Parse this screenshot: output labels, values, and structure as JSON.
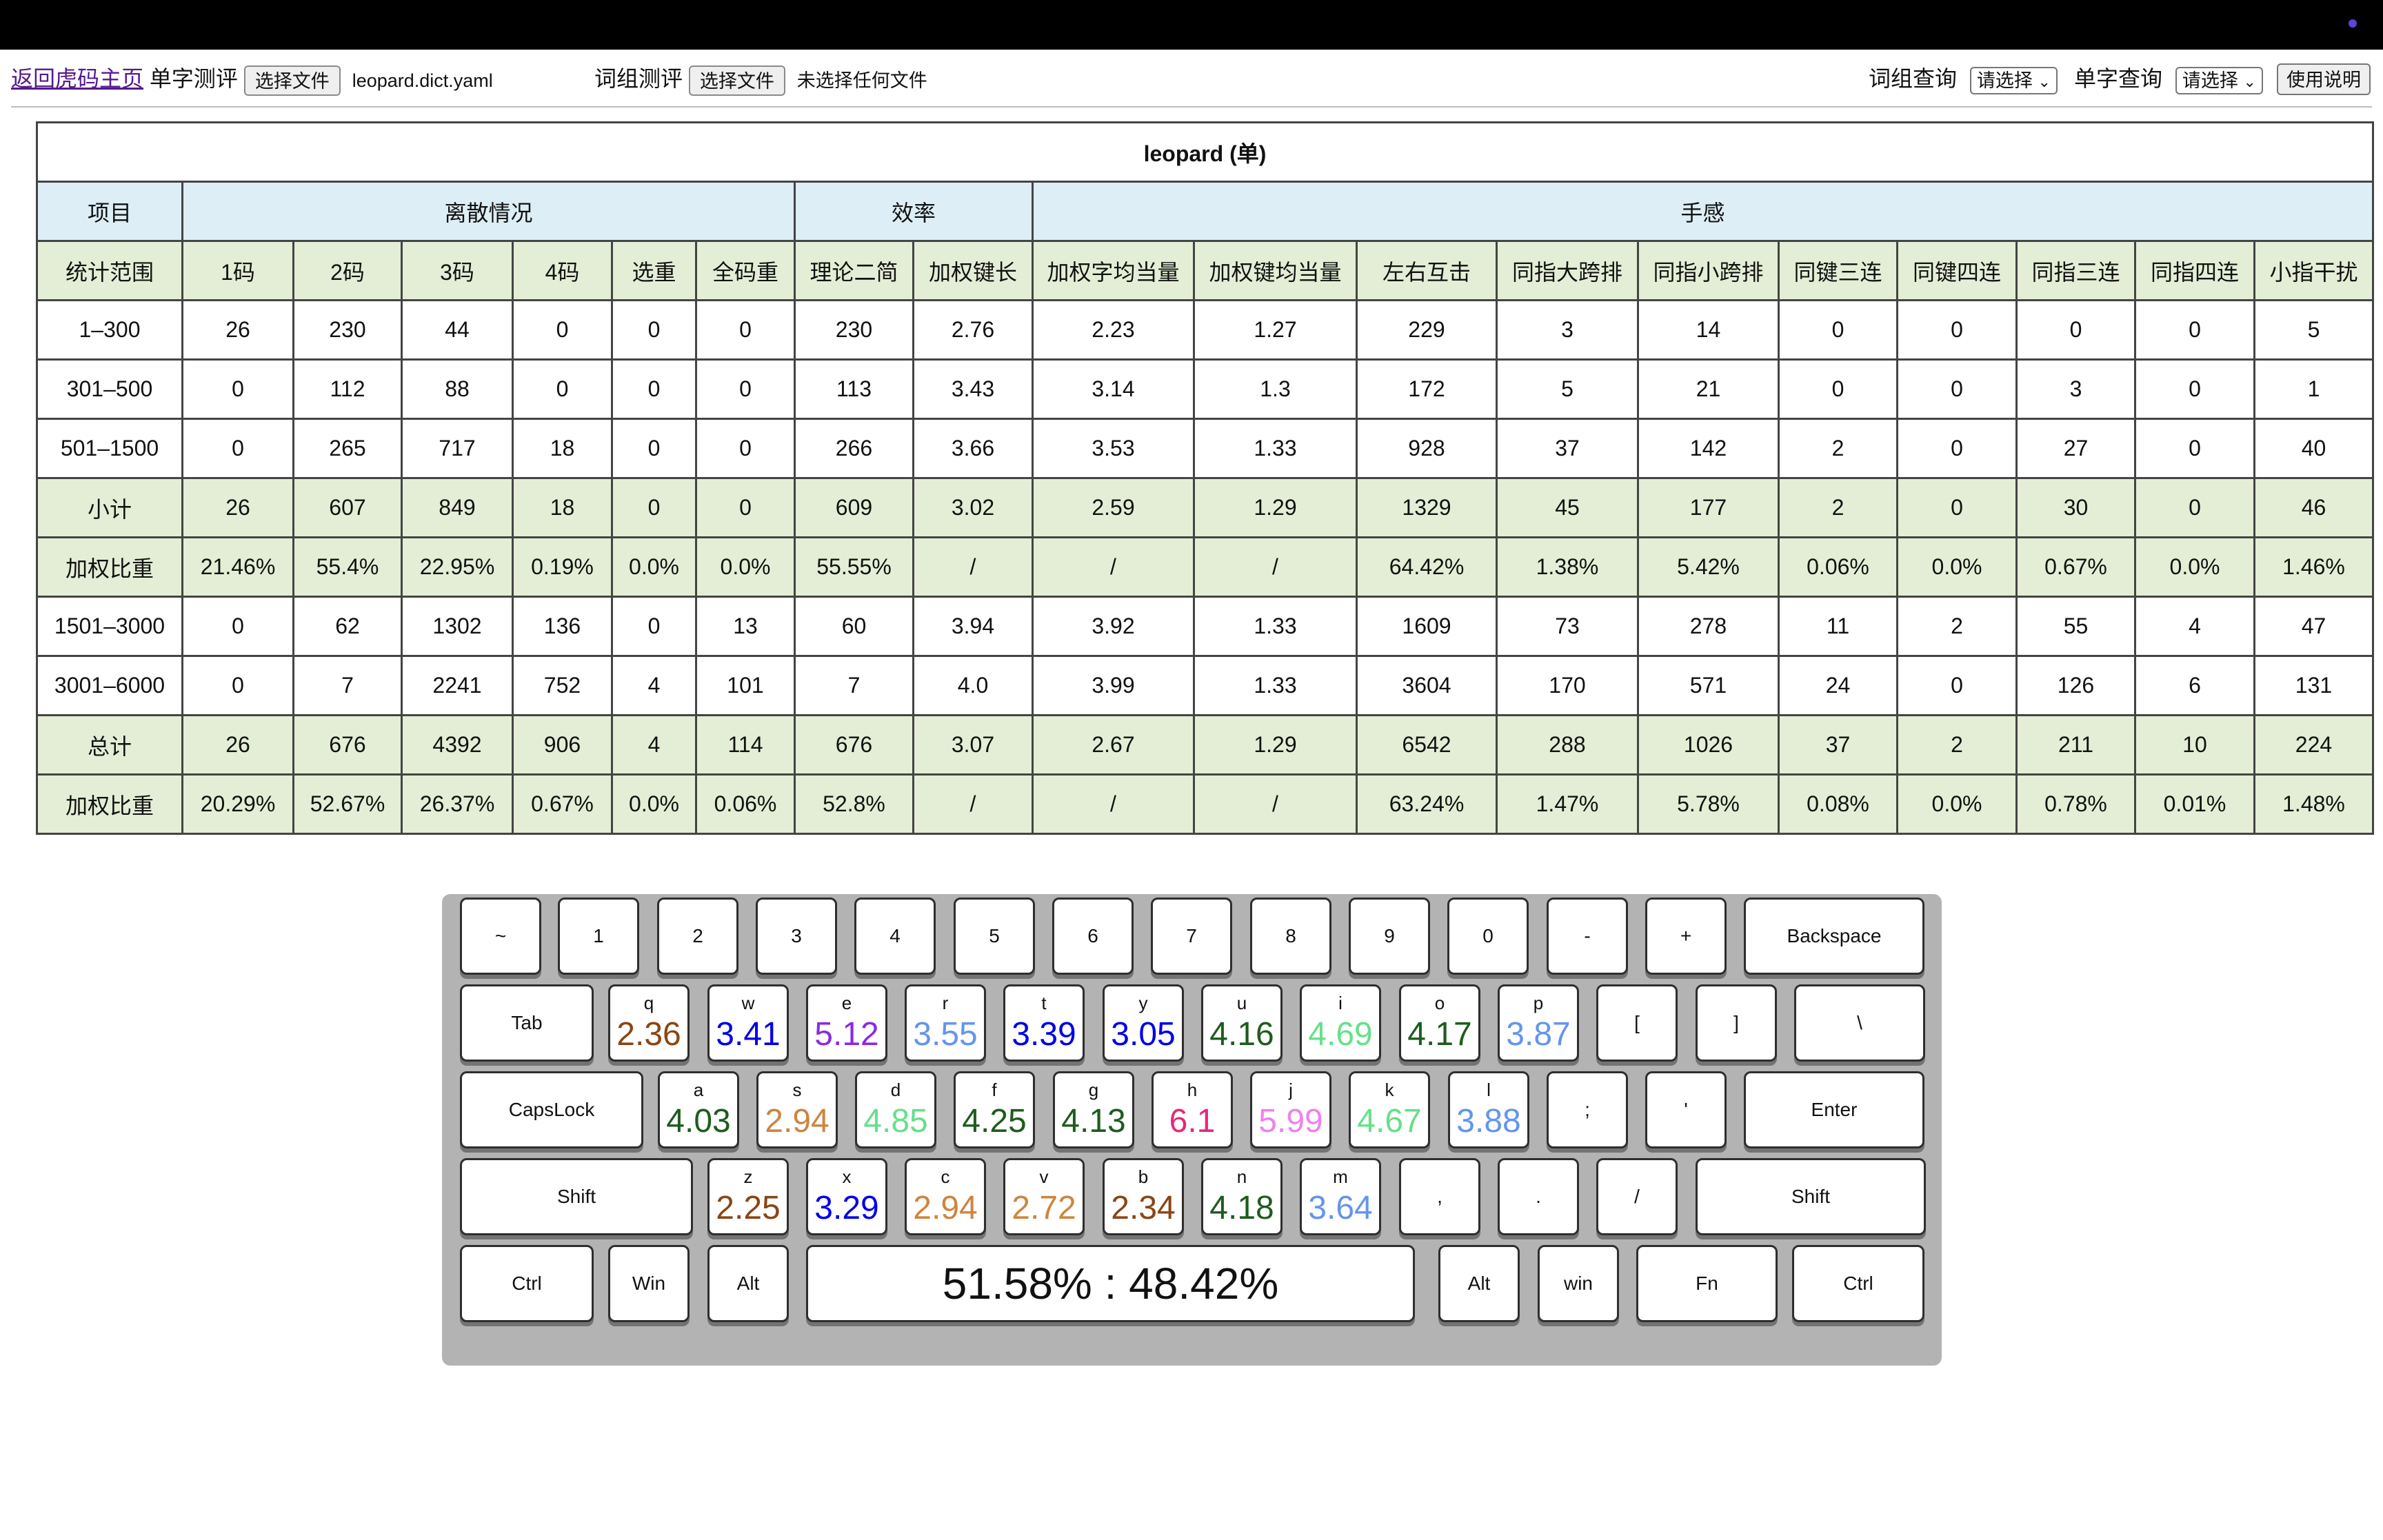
{
  "toolbar": {
    "back_link": "返回虎码主页",
    "single_test_label": "单字测评",
    "choose_file": "选择文件",
    "single_file_name": "leopard.dict.yaml",
    "phrase_test_label": "词组测评",
    "phrase_file_name": "未选择任何文件",
    "phrase_query_label": "词组查询",
    "single_query_label": "单字查询",
    "select_placeholder": "请选择",
    "help_button": "使用说明"
  },
  "table": {
    "title": "leopard (单)",
    "groups": [
      {
        "label": "项目",
        "span": 1
      },
      {
        "label": "离散情况",
        "span": 6
      },
      {
        "label": "效率",
        "span": 2
      },
      {
        "label": "手感",
        "span": 11
      }
    ],
    "columns": [
      "统计范围",
      "1码",
      "2码",
      "3码",
      "4码",
      "选重",
      "全码重",
      "理论二简",
      "加权键长",
      "加权字均当量",
      "加权键均当量",
      "左右互击",
      "同指大跨排",
      "同指小跨排",
      "同键三连",
      "同键四连",
      "同指三连",
      "同指四连",
      "小指干扰"
    ],
    "rows": [
      {
        "style": "white",
        "cells": [
          "1–300",
          "26",
          "230",
          "44",
          "0",
          "0",
          "0",
          "230",
          "2.76",
          "2.23",
          "1.27",
          "229",
          "3",
          "14",
          "0",
          "0",
          "0",
          "0",
          "5"
        ]
      },
      {
        "style": "white",
        "cells": [
          "301–500",
          "0",
          "112",
          "88",
          "0",
          "0",
          "0",
          "113",
          "3.43",
          "3.14",
          "1.3",
          "172",
          "5",
          "21",
          "0",
          "0",
          "3",
          "0",
          "1"
        ]
      },
      {
        "style": "white",
        "cells": [
          "501–1500",
          "0",
          "265",
          "717",
          "18",
          "0",
          "0",
          "266",
          "3.66",
          "3.53",
          "1.33",
          "928",
          "37",
          "142",
          "2",
          "0",
          "27",
          "0",
          "40"
        ]
      },
      {
        "style": "green",
        "cells": [
          "小计",
          "26",
          "607",
          "849",
          "18",
          "0",
          "0",
          "609",
          "3.02",
          "2.59",
          "1.29",
          "1329",
          "45",
          "177",
          "2",
          "0",
          "30",
          "0",
          "46"
        ]
      },
      {
        "style": "green",
        "cells": [
          "加权比重",
          "21.46%",
          "55.4%",
          "22.95%",
          "0.19%",
          "0.0%",
          "0.0%",
          "55.55%",
          "/",
          "/",
          "/",
          "64.42%",
          "1.38%",
          "5.42%",
          "0.06%",
          "0.0%",
          "0.67%",
          "0.0%",
          "1.46%"
        ]
      },
      {
        "style": "white",
        "cells": [
          "1501–3000",
          "0",
          "62",
          "1302",
          "136",
          "0",
          "13",
          "60",
          "3.94",
          "3.92",
          "1.33",
          "1609",
          "73",
          "278",
          "11",
          "2",
          "55",
          "4",
          "47"
        ]
      },
      {
        "style": "white",
        "cells": [
          "3001–6000",
          "0",
          "7",
          "2241",
          "752",
          "4",
          "101",
          "7",
          "4.0",
          "3.99",
          "1.33",
          "3604",
          "170",
          "571",
          "24",
          "0",
          "126",
          "6",
          "131"
        ]
      },
      {
        "style": "green",
        "cells": [
          "总计",
          "26",
          "676",
          "4392",
          "906",
          "4",
          "114",
          "676",
          "3.07",
          "2.67",
          "1.29",
          "6542",
          "288",
          "1026",
          "37",
          "2",
          "211",
          "10",
          "224"
        ]
      },
      {
        "style": "green",
        "cells": [
          "加权比重",
          "20.29%",
          "52.67%",
          "26.37%",
          "0.67%",
          "0.0%",
          "0.06%",
          "52.8%",
          "/",
          "/",
          "/",
          "63.24%",
          "1.47%",
          "5.78%",
          "0.08%",
          "0.0%",
          "0.78%",
          "0.01%",
          "1.48%"
        ]
      }
    ]
  },
  "keyboard": {
    "hand_ratio": "51.58% : 48.42%",
    "rows": [
      [
        {
          "l": "~"
        },
        {
          "l": "1"
        },
        {
          "l": "2"
        },
        {
          "l": "3"
        },
        {
          "l": "4"
        },
        {
          "l": "5"
        },
        {
          "l": "6"
        },
        {
          "l": "7"
        },
        {
          "l": "8"
        },
        {
          "l": "9"
        },
        {
          "l": "0"
        },
        {
          "l": "-"
        },
        {
          "l": "+"
        },
        {
          "l": "Backspace"
        }
      ],
      [
        {
          "l": "Tab"
        },
        {
          "k": "q",
          "v": "2.36",
          "c": "#8b4513"
        },
        {
          "k": "w",
          "v": "3.41",
          "c": "#0000e6"
        },
        {
          "k": "e",
          "v": "5.12",
          "c": "#8a2be2"
        },
        {
          "k": "r",
          "v": "3.55",
          "c": "#6495ed"
        },
        {
          "k": "t",
          "v": "3.39",
          "c": "#0000e6"
        },
        {
          "k": "y",
          "v": "3.05",
          "c": "#0000e6"
        },
        {
          "k": "u",
          "v": "4.16",
          "c": "#1e5c1e"
        },
        {
          "k": "i",
          "v": "4.69",
          "c": "#66e08a"
        },
        {
          "k": "o",
          "v": "4.17",
          "c": "#1e5c1e"
        },
        {
          "k": "p",
          "v": "3.87",
          "c": "#6495ed"
        },
        {
          "l": "["
        },
        {
          "l": "]"
        },
        {
          "l": "\\"
        }
      ],
      [
        {
          "l": "CapsLock"
        },
        {
          "k": "a",
          "v": "4.03",
          "c": "#1e5c1e"
        },
        {
          "k": "s",
          "v": "2.94",
          "c": "#cd853f"
        },
        {
          "k": "d",
          "v": "4.85",
          "c": "#66e08a"
        },
        {
          "k": "f",
          "v": "4.25",
          "c": "#1e5c1e"
        },
        {
          "k": "g",
          "v": "4.13",
          "c": "#1e5c1e"
        },
        {
          "k": "h",
          "v": "6.1",
          "c": "#e6287a"
        },
        {
          "k": "j",
          "v": "5.99",
          "c": "#ee82ee"
        },
        {
          "k": "k",
          "v": "4.67",
          "c": "#66e08a"
        },
        {
          "k": "l",
          "v": "3.88",
          "c": "#6495ed"
        },
        {
          "l": ";"
        },
        {
          "l": "'"
        },
        {
          "l": "Enter"
        }
      ],
      [
        {
          "l": "Shift"
        },
        {
          "k": "z",
          "v": "2.25",
          "c": "#8b4513"
        },
        {
          "k": "x",
          "v": "3.29",
          "c": "#0000e6"
        },
        {
          "k": "c",
          "v": "2.94",
          "c": "#cd853f"
        },
        {
          "k": "v",
          "v": "2.72",
          "c": "#cd853f"
        },
        {
          "k": "b",
          "v": "2.34",
          "c": "#8b4513"
        },
        {
          "k": "n",
          "v": "4.18",
          "c": "#1e5c1e"
        },
        {
          "k": "m",
          "v": "3.64",
          "c": "#6495ed"
        },
        {
          "l": ","
        },
        {
          "l": "."
        },
        {
          "l": "/"
        },
        {
          "l": "Shift"
        }
      ],
      [
        {
          "l": "Ctrl"
        },
        {
          "l": "Win"
        },
        {
          "l": "Alt"
        },
        {
          "space": true
        },
        {
          "l": "Alt"
        },
        {
          "l": "win"
        },
        {
          "l": "Fn"
        },
        {
          "l": "Ctrl"
        }
      ]
    ]
  }
}
